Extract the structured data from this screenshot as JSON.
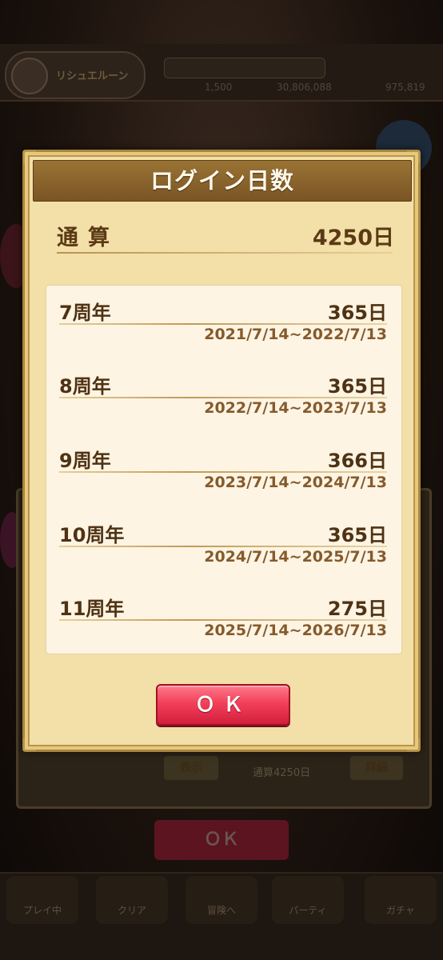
{
  "background": {
    "player_name": "リシュエルーン",
    "stats": [
      "1,500",
      "30,806,088",
      "975,819"
    ],
    "quest_label": "",
    "detail_buttons": [
      "表示",
      "詳細"
    ],
    "login_summary": "通算4250日",
    "ok_label": "ＯＫ",
    "tabs": [
      "プレイ中",
      "クリア",
      "冒険へ",
      "パーティ",
      "ガチャ"
    ]
  },
  "dialog": {
    "title": "ログイン日数",
    "total_label": "通算",
    "total_value": "4250日",
    "entries": [
      {
        "label": "7周年",
        "days": "365日",
        "range": "2021/7/14~2022/7/13"
      },
      {
        "label": "8周年",
        "days": "365日",
        "range": "2022/7/14~2023/7/13"
      },
      {
        "label": "9周年",
        "days": "366日",
        "range": "2023/7/14~2024/7/13"
      },
      {
        "label": "10周年",
        "days": "365日",
        "range": "2024/7/14~2025/7/13"
      },
      {
        "label": "11周年",
        "days": "275日",
        "range": "2025/7/14~2026/7/13"
      }
    ],
    "ok_label": "ＯＫ"
  },
  "colors": {
    "dialog_bg": "#f3dfa8",
    "title_bar": "#8a642c",
    "text_brown": "#4f3214",
    "ok_red": "#f2405a"
  }
}
